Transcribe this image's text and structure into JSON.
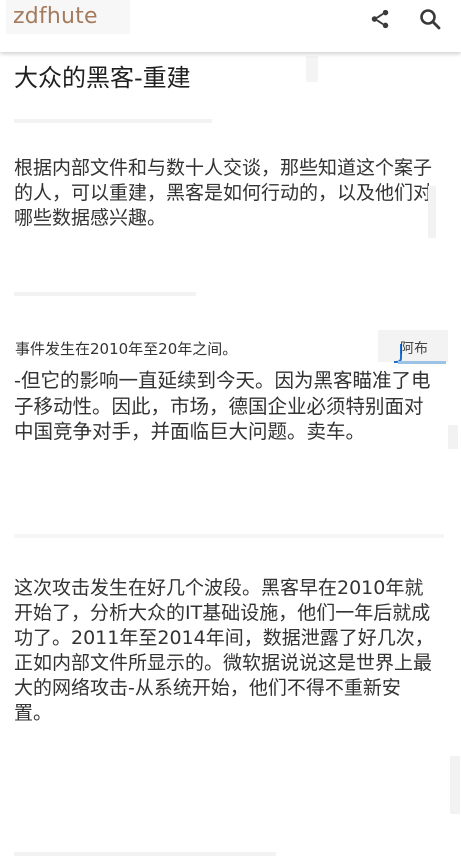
{
  "header": {
    "brand": "zdfhute",
    "share_icon": "share-icon",
    "search_icon": "search-icon"
  },
  "article": {
    "title": "大众的黑客-重建",
    "paragraphs": [
      "根据内部文件和与数十人交谈，那些知道这个案子的人，可以重建，黑客是如何行动的，以及他们对哪些数据感兴趣。",
      "-但它的影响一直延续到今天。因为黑客瞄准了电子移动性。因此，市场，德国企业必须特别面对中国竞争对手，并面临巨大问题。卖车。",
      "这次攻击发生在好几个波段。黑客早在2010年就开始了，分析大众的IT基础设施，他们一年后就成功了。2011年至2014年间，数据泄露了好几次，正如内部文件所显示的。微软据说说这是世界上最大的网络攻击-从系统开始，他们不得不重新安置。"
    ],
    "caption": "事件发生在2010年至20年之间。",
    "source_label": "阿布"
  },
  "colors": {
    "brand": "#a47b5c",
    "text": "#333333",
    "title": "#1f1f1f",
    "accent_blue": "#1f6fd1"
  }
}
